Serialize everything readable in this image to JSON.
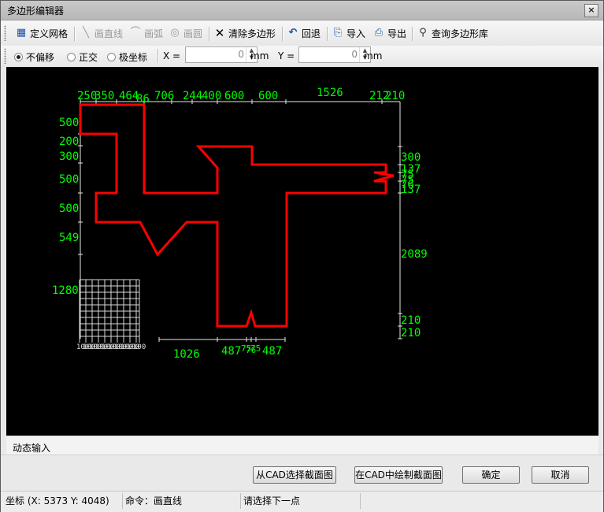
{
  "window": {
    "title": "多边形编辑器",
    "close_label": "×"
  },
  "toolbar": {
    "define_grid": "定义网格",
    "draw_line": "画直线",
    "draw_arc": "画弧",
    "draw_circle": "画圆",
    "clear_polygon": "清除多边形",
    "undo": "回退",
    "import": "导入",
    "export": "导出",
    "query_library": "查询多边形库"
  },
  "options": {
    "no_offset": "不偏移",
    "ortho": "正交",
    "polar": "极坐标",
    "selected": "no_offset",
    "x_label": "X =",
    "x_value": "0",
    "x_unit": "mm",
    "y_label": "Y =",
    "y_value": "0",
    "y_unit": "mm"
  },
  "canvas": {
    "top_dims": [
      "250",
      "350",
      "464",
      "86",
      "706",
      "244",
      "400",
      "600",
      "600",
      "1526",
      "212",
      "210"
    ],
    "left_dims": [
      "500",
      "200",
      "300",
      "500",
      "500",
      "549",
      "1280"
    ],
    "right_dims": [
      "300",
      "137",
      "75",
      "75",
      "76",
      "137",
      "2089",
      "210",
      "210"
    ],
    "bottom_dims": [
      "1026",
      "487",
      "75",
      "76",
      "75",
      "487"
    ],
    "grid_labels": [
      "100",
      "100",
      "100",
      "100",
      "100",
      "100",
      "100",
      "100",
      "100",
      "100"
    ],
    "polygon_color": "#ff0000",
    "dim_color": "#00ff00"
  },
  "dynamic_input": {
    "label": "动态输入"
  },
  "buttons": {
    "select_from_cad": "从CAD选择截面图",
    "draw_in_cad": "在CAD中绘制截面图",
    "ok": "确定",
    "cancel": "取消"
  },
  "status": {
    "coords": "坐标 (X: 5373 Y: 4048)",
    "command": "命令：画直线",
    "prompt": "请选择下一点"
  }
}
